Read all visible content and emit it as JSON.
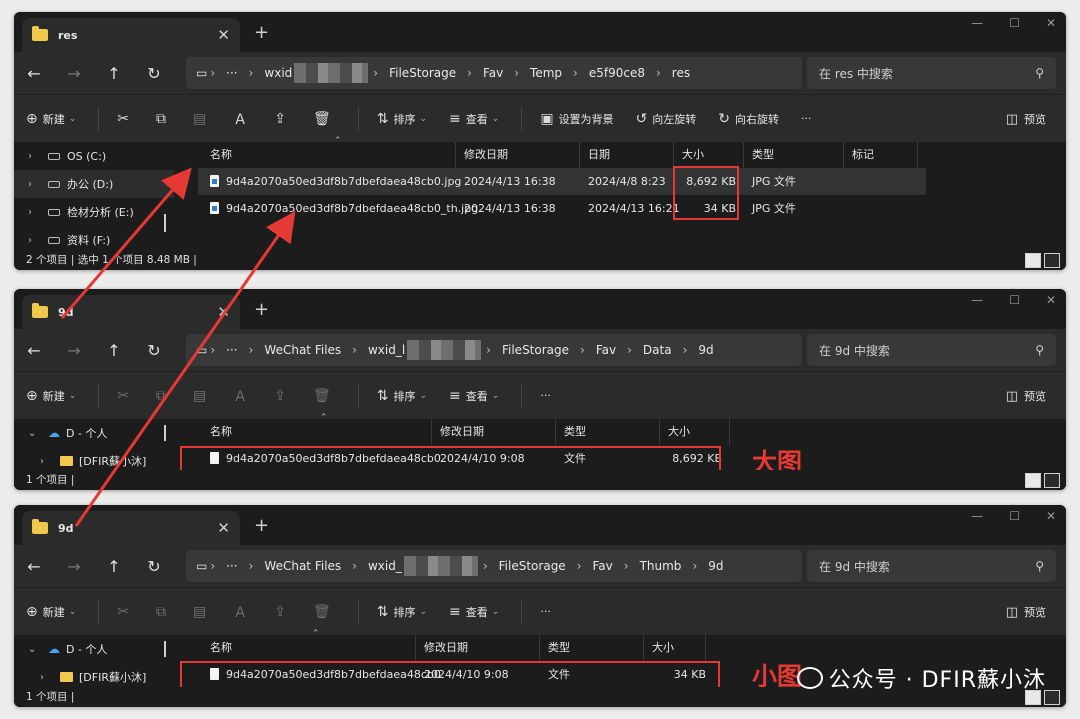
{
  "windows": [
    {
      "tab_title": "res",
      "address": [
        "wxid",
        "FileStorage",
        "Fav",
        "Temp",
        "e5f90ce8",
        "res"
      ],
      "search_placeholder": "在 res 中搜索",
      "toolbar": {
        "new": "新建",
        "sort": "排序",
        "view": "查看",
        "set_bg": "设置为背景",
        "rotate_left": "向左旋转",
        "rotate_right": "向右旋转",
        "more": "···",
        "preview": "预览"
      },
      "nav": [
        "OS (C:)",
        "办公 (D:)",
        "检材分析 (E:)",
        "资料 (F:)"
      ],
      "headers": [
        "名称",
        "修改日期",
        "日期",
        "大小",
        "类型",
        "标记"
      ],
      "files": [
        {
          "name": "9d4a2070a50ed3df8b7dbefdaea48cb0.jpg",
          "modified": "2024/4/13 16:38",
          "date": "2024/4/8 8:23",
          "size": "8,692 KB",
          "type": "JPG 文件"
        },
        {
          "name": "9d4a2070a50ed3df8b7dbefdaea48cb0_th.jpg",
          "modified": "2024/4/13 16:38",
          "date": "2024/4/13 16:21",
          "size": "34 KB",
          "type": "JPG 文件"
        }
      ],
      "status": "2 个项目  |  选中 1 个项目  8.48 MB  |"
    },
    {
      "tab_title": "9d",
      "address": [
        "WeChat Files",
        "wxid_l",
        "FileStorage",
        "Fav",
        "Data",
        "9d"
      ],
      "search_placeholder": "在 9d 中搜索",
      "toolbar": {
        "new": "新建",
        "sort": "排序",
        "view": "查看",
        "more": "···",
        "preview": "预览"
      },
      "nav": [
        "D - 个人",
        "[DFIR蘇小沐]"
      ],
      "headers": [
        "名称",
        "修改日期",
        "类型",
        "大小"
      ],
      "files": [
        {
          "name": "9d4a2070a50ed3df8b7dbefdaea48cb0",
          "modified": "2024/4/10 9:08",
          "type": "文件",
          "size": "8,692 KB"
        }
      ],
      "status": "1 个项目  |",
      "annotation": "大图"
    },
    {
      "tab_title": "9d",
      "address": [
        "WeChat Files",
        "wxid_",
        "FileStorage",
        "Fav",
        "Thumb",
        "9d"
      ],
      "search_placeholder": "在 9d 中搜索",
      "toolbar": {
        "new": "新建",
        "sort": "排序",
        "view": "查看",
        "more": "···",
        "preview": "预览"
      },
      "nav": [
        "D - 个人",
        "[DFIR蘇小沐]"
      ],
      "headers": [
        "名称",
        "修改日期",
        "类型",
        "大小"
      ],
      "files": [
        {
          "name": "9d4a2070a50ed3df8b7dbefdaea48cb0",
          "modified": "2024/4/10 9:08",
          "type": "文件",
          "size": "34 KB"
        }
      ],
      "status": "1 个项目  |",
      "annotation": "小图"
    }
  ],
  "watermark": "公众号 · DFIR蘇小沐",
  "colors": {
    "annotation_red": "#e53935",
    "window_bg": "#202020",
    "folder": "#f2c94c"
  }
}
